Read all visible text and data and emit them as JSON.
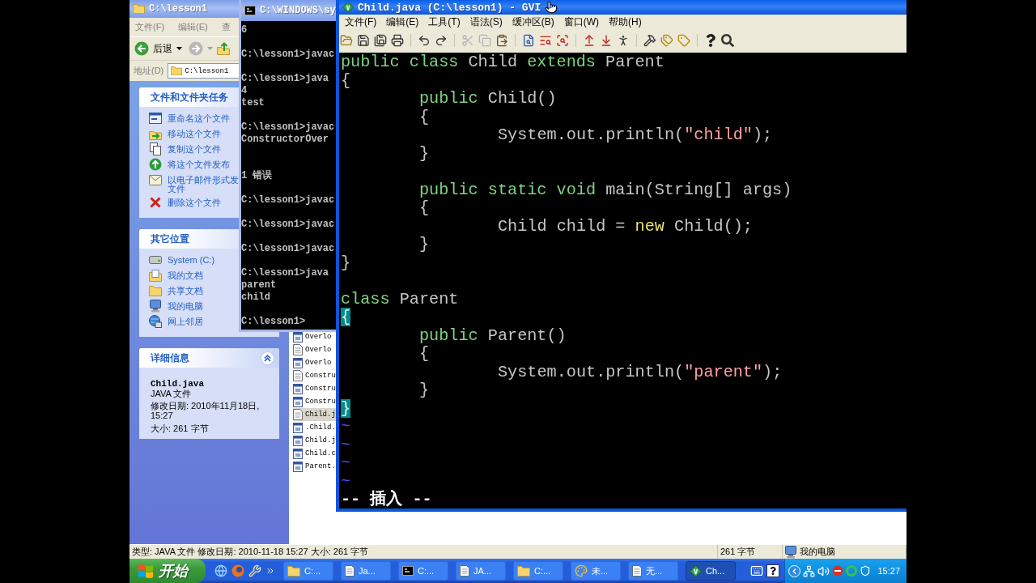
{
  "explorer": {
    "active": false,
    "title": "C:\\lesson1",
    "menu": [
      "文件(F)",
      "编辑(E)",
      "查"
    ],
    "back": {
      "label": "后退",
      "disabled": false
    },
    "forward": {
      "disabled": true
    },
    "address": {
      "label": "地址(D)",
      "value": "C:\\lesson1"
    },
    "task_panels": [
      {
        "title": "文件和文件夹任务",
        "items": [
          "重命名这个文件",
          "移动这个文件",
          "复制这个文件",
          "将这个文件发布",
          "以电子邮件形式发文件",
          "删除这个文件"
        ]
      },
      {
        "title": "其它位置",
        "items": [
          "System (C:)",
          "我的文档",
          "共享文档",
          "我的电脑",
          "网上邻居"
        ]
      }
    ],
    "details": {
      "title": "详细信息",
      "expanded": true,
      "name": "Child.java",
      "type": "JAVA 文件",
      "modified": "修改日期: 2010年11月18日, 15:27",
      "size": "大小: 261 字节"
    },
    "files": [
      {
        "name": "Overlo",
        "kind": "app",
        "selected": false
      },
      {
        "name": "Overlo",
        "kind": "document",
        "selected": false
      },
      {
        "name": "Overlo",
        "kind": "app",
        "selected": false
      },
      {
        "name": "Constru",
        "kind": "document",
        "selected": false
      },
      {
        "name": "Constru",
        "kind": "app",
        "selected": false
      },
      {
        "name": "Constru",
        "kind": "app",
        "selected": false
      },
      {
        "name": "Child.j",
        "kind": "document",
        "selected": true
      },
      {
        "name": ".Child.",
        "kind": "app",
        "selected": false
      },
      {
        "name": "Child.j",
        "kind": "app",
        "selected": false
      },
      {
        "name": "Child.c",
        "kind": "app",
        "selected": false
      },
      {
        "name": "Parent.",
        "kind": "app",
        "selected": false
      }
    ],
    "status_bar": [
      "类型: JAVA 文件 修改日期: 2010-11-18 15:27 大小: 261 字节",
      "261 字节",
      "我的电脑"
    ]
  },
  "console": {
    "active": false,
    "title": "C:\\WINDOWS\\sy",
    "blocks": [
      {
        "kind": "output",
        "lines": [
          "6"
        ]
      },
      {
        "kind": "output",
        "lines": [
          "C:\\lesson1>javac"
        ]
      },
      {
        "kind": "output",
        "lines": [
          "C:\\lesson1>java",
          "4",
          "test"
        ]
      },
      {
        "kind": "output",
        "lines": [
          "C:\\lesson1>javac",
          "ConstructorOver"
        ]
      },
      {
        "kind": "summary",
        "lines": [
          "1 错误"
        ]
      },
      {
        "kind": "output",
        "lines": [
          "C:\\lesson1>javac"
        ]
      },
      {
        "kind": "output",
        "lines": [
          "C:\\lesson1>javac"
        ]
      },
      {
        "kind": "output",
        "lines": [
          "C:\\lesson1>javac"
        ]
      },
      {
        "kind": "output",
        "lines": [
          "C:\\lesson1>java",
          "parent",
          "child"
        ]
      },
      {
        "kind": "output",
        "lines": [
          "C:\\lesson1>"
        ]
      }
    ]
  },
  "editor": {
    "active": true,
    "title": "Child.java (C:\\lesson1) - GVI",
    "menu": [
      "文件(F)",
      "编辑(E)",
      "工具(T)",
      "语法(S)",
      "缓冲区(B)",
      "窗口(W)",
      "帮助(H)"
    ],
    "toolbar": [
      [
        {
          "disabled": false
        },
        {
          "disabled": false
        },
        {
          "disabled": false
        },
        {
          "disabled": false
        }
      ],
      [
        {
          "disabled": false
        },
        {
          "disabled": false
        }
      ],
      [
        {
          "disabled": true
        },
        {
          "disabled": true
        },
        {
          "disabled": false
        }
      ],
      [
        {
          "disabled": false
        },
        {
          "disabled": false
        },
        {
          "disabled": false
        }
      ],
      [
        {
          "disabled": false
        },
        {
          "disabled": false
        },
        {
          "disabled": false
        }
      ],
      [
        {
          "disabled": false
        },
        {
          "disabled": false
        },
        {
          "disabled": false
        }
      ],
      [
        {
          "disabled": false
        },
        {
          "disabled": false
        }
      ]
    ],
    "lines": [
      {
        "kind": "code",
        "tokens": [
          {
            "kind": "keyword",
            "text": "public class"
          },
          {
            "kind": "plain",
            "text": " Child "
          },
          {
            "kind": "keyword",
            "text": "extends"
          },
          {
            "kind": "plain",
            "text": " Parent"
          }
        ]
      },
      {
        "kind": "code",
        "tokens": [
          {
            "kind": "plain",
            "text": "{"
          }
        ]
      },
      {
        "kind": "block",
        "children": [
          {
            "kind": "code",
            "tokens": [
              {
                "kind": "keyword",
                "text": "public"
              },
              {
                "kind": "plain",
                "text": " Child()"
              }
            ]
          },
          {
            "kind": "code",
            "tokens": [
              {
                "kind": "plain",
                "text": "{"
              }
            ]
          },
          {
            "kind": "block",
            "children": [
              {
                "kind": "code",
                "tokens": [
                  {
                    "kind": "plain",
                    "text": "System.out.println("
                  },
                  {
                    "kind": "string",
                    "text": "\"child\""
                  },
                  {
                    "kind": "plain",
                    "text": ");"
                  }
                ]
              }
            ]
          },
          {
            "kind": "code",
            "tokens": [
              {
                "kind": "plain",
                "text": "}"
              }
            ]
          },
          {
            "kind": "blank"
          },
          {
            "kind": "code",
            "tokens": [
              {
                "kind": "keyword",
                "text": "public static void"
              },
              {
                "kind": "plain",
                "text": " main(String[] args)"
              }
            ]
          },
          {
            "kind": "code",
            "tokens": [
              {
                "kind": "plain",
                "text": "{"
              }
            ]
          },
          {
            "kind": "block",
            "children": [
              {
                "kind": "code",
                "tokens": [
                  {
                    "kind": "plain",
                    "text": "Child child = "
                  },
                  {
                    "kind": "operator",
                    "text": "new"
                  },
                  {
                    "kind": "plain",
                    "text": " Child();"
                  }
                ]
              }
            ]
          },
          {
            "kind": "code",
            "tokens": [
              {
                "kind": "plain",
                "text": "}"
              }
            ]
          }
        ]
      },
      {
        "kind": "code",
        "tokens": [
          {
            "kind": "plain",
            "text": "}"
          }
        ]
      },
      {
        "kind": "blank"
      },
      {
        "kind": "code",
        "tokens": [
          {
            "kind": "keyword",
            "text": "class"
          },
          {
            "kind": "plain",
            "text": " Parent"
          }
        ]
      },
      {
        "kind": "code",
        "tokens": [
          {
            "kind": "match",
            "text": "{"
          }
        ]
      },
      {
        "kind": "block",
        "children": [
          {
            "kind": "code",
            "tokens": [
              {
                "kind": "keyword",
                "text": "public"
              },
              {
                "kind": "plain",
                "text": " Parent()"
              }
            ]
          },
          {
            "kind": "code",
            "tokens": [
              {
                "kind": "plain",
                "text": "{"
              }
            ]
          },
          {
            "kind": "block",
            "children": [
              {
                "kind": "code",
                "tokens": [
                  {
                    "kind": "plain",
                    "text": "System.out.println("
                  },
                  {
                    "kind": "string",
                    "text": "\"parent\""
                  },
                  {
                    "kind": "plain",
                    "text": ");"
                  }
                ]
              }
            ]
          },
          {
            "kind": "code",
            "tokens": [
              {
                "kind": "plain",
                "text": "}"
              }
            ]
          }
        ]
      },
      {
        "kind": "code",
        "tokens": [
          {
            "kind": "match",
            "text": "}"
          }
        ]
      },
      {
        "kind": "filler",
        "text": "~"
      },
      {
        "kind": "filler",
        "text": "~"
      },
      {
        "kind": "filler",
        "text": "~"
      },
      {
        "kind": "filler",
        "text": "~"
      }
    ],
    "mode": "-- 插入 --"
  },
  "taskbar": {
    "start": "开始",
    "tasks": [
      {
        "label": "C:...",
        "selected": false
      },
      {
        "label": "Ja...",
        "selected": false
      },
      {
        "label": "C:...",
        "selected": false
      },
      {
        "label": "JA...",
        "selected": false
      },
      {
        "label": "C:...",
        "selected": false
      },
      {
        "label": "未...",
        "selected": false
      },
      {
        "label": "无...",
        "selected": false
      },
      {
        "label": "Ch...",
        "selected": true
      }
    ],
    "clock": "15:27"
  }
}
